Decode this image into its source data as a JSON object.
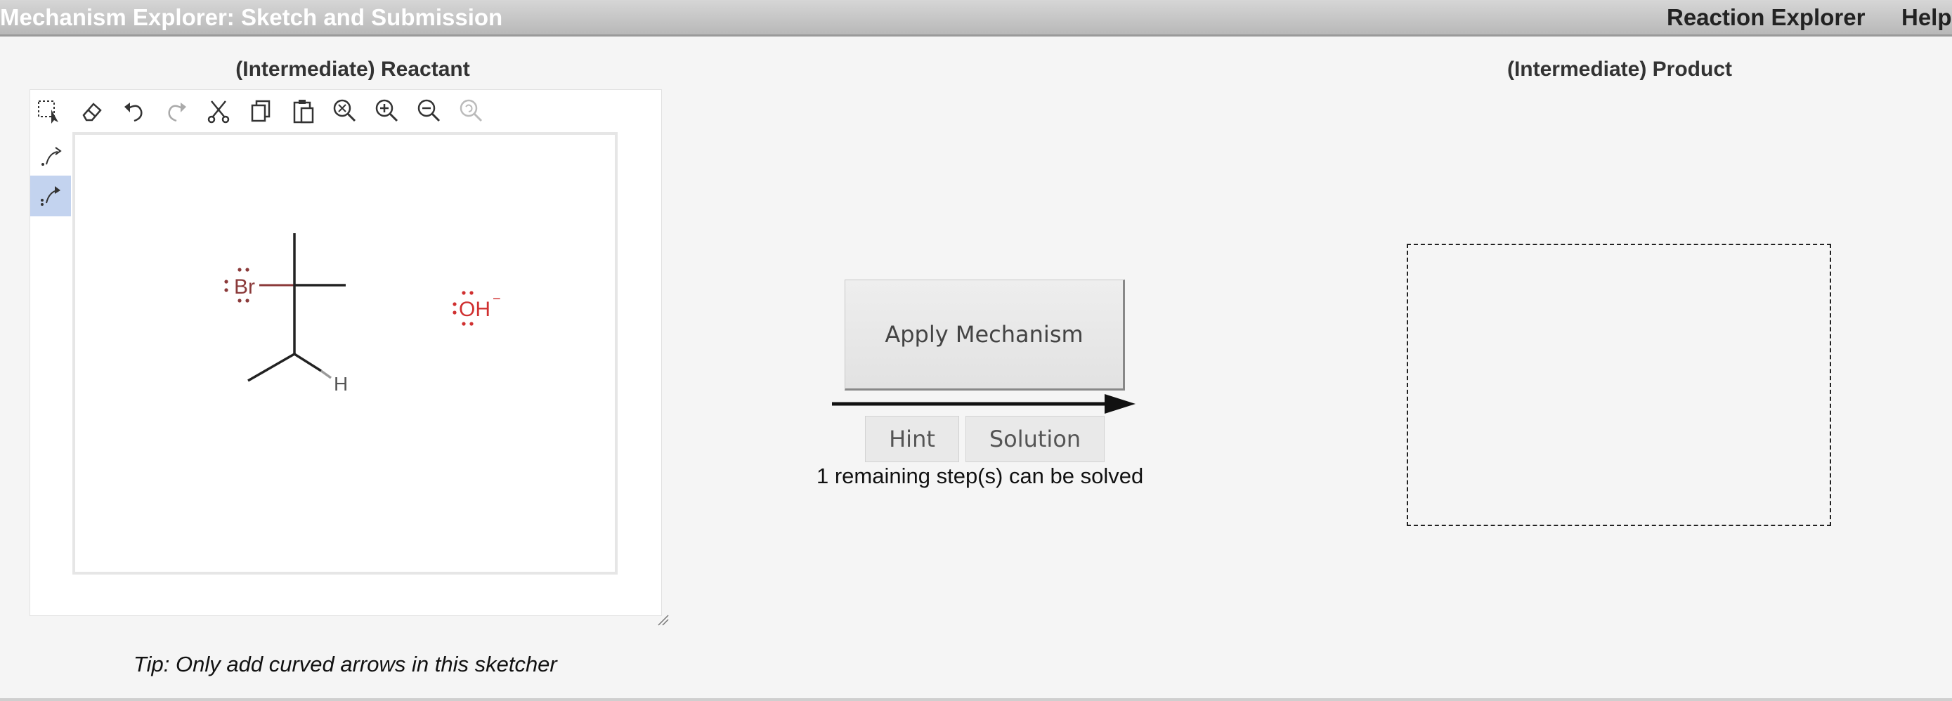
{
  "app": {
    "title": "Mechanism Explorer: Sketch and Submission",
    "nav": {
      "reaction_explorer": "Reaction Explorer",
      "help": "Help"
    }
  },
  "reactant_panel": {
    "title": "(Intermediate) Reactant",
    "toolbar": [
      "selection-icon",
      "eraser-icon",
      "undo-icon",
      "redo-icon",
      "cut-icon",
      "copy-icon",
      "paste-icon",
      "zoom-fit-icon",
      "zoom-in-icon",
      "zoom-out-icon",
      "zoom-reset-icon"
    ],
    "side_tools": [
      {
        "icon": "single-electron-arrow-icon",
        "active": false
      },
      {
        "icon": "electron-pair-arrow-icon",
        "active": true
      }
    ],
    "molecules": {
      "bromine_label": "Br",
      "hydrogen_label": "H",
      "hydroxide_label": "OH",
      "hydroxide_charge": "−"
    },
    "tip": "Tip: Only add curved arrows in this sketcher"
  },
  "center": {
    "apply_button": "Apply Mechanism",
    "hint_button": "Hint",
    "solution_button": "Solution",
    "status": "1 remaining step(s) can be solved"
  },
  "product_panel": {
    "title": "(Intermediate) Product"
  },
  "colors": {
    "titlebar": "#c6c6c6",
    "active_tool": "#c3d3ef",
    "bromine": "#8b3a3a",
    "hydroxide": "#d03030"
  }
}
